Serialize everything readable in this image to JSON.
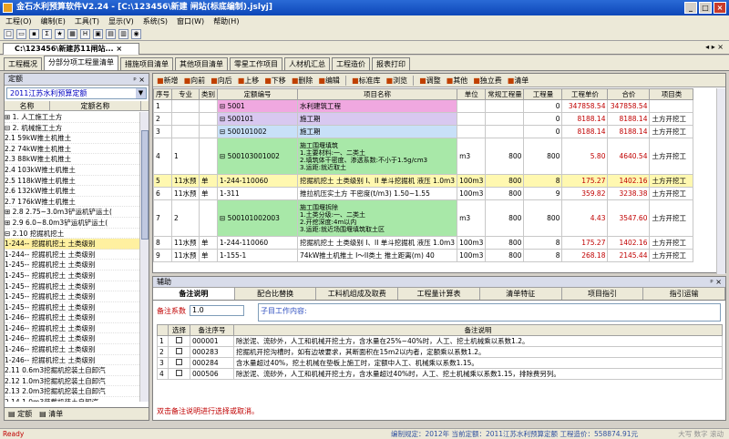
{
  "title": "金石水利预算软件V2.24 - [C:\\123456\\新建      闸站(标底编制).jslyj]",
  "menu": [
    "工程(O)",
    "编制(E)",
    "工具(T)",
    "显示(V)",
    "系统(S)",
    "窗口(W)",
    "帮助(H)"
  ],
  "doc_tab": "C:\\123456\\新建苏11闸站...",
  "main_tabs": [
    "工程概况",
    "分部分项工程量清单",
    "措施项目清单",
    "其他项目清单",
    "零星工作项目",
    "人材机汇总",
    "工程造价",
    "报表打印"
  ],
  "left": {
    "title": "定额",
    "combo": "2011江苏水利预算定额",
    "col_name": "名称",
    "col_code": "定额名称",
    "tree": [
      "⊞ 1. 人工施工土方",
      "⊟ 2. 机械施工土方",
      "  2.1 59kW推土机推土",
      "  2.2 74kW推土机推土",
      "  2.3 88kW推土机推土",
      "  2.4 103kW推土机推土",
      "  2.5 118kW推土机推土",
      "  2.6 132kW推土机推土",
      "  2.7 176kW推土机推土",
      "⊞ 2.8 2.75~3.0m3铲运机铲运土(",
      "⊞ 2.9 6.0~8.0m3铲运机铲运土(",
      "⊟ 2.10 挖掘机挖土",
      "   1-244-- 挖掘机挖土 土类级别",
      "   1-244-- 挖掘机挖土 土类级别",
      "   1-245-- 挖掘机挖土 土类级别",
      "   1-245-- 挖掘机挖土 土类级别",
      "   1-245-- 挖掘机挖土 土类级别",
      "   1-245-- 挖掘机挖土 土类级别",
      "   1-245-- 挖掘机挖土 土类级别",
      "   1-246-- 挖掘机挖土 土类级别",
      "   1-246-- 挖掘机挖土 土类级别",
      "   1-246-- 挖掘机挖土 土类级别",
      "   1-246-- 挖掘机挖土 土类级别",
      "   1-246-- 挖掘机挖土 土类级别",
      "  2.11 0.6m3挖掘机挖装土自卸汽",
      "  2.12 1.0m3挖掘机挖装土自卸汽",
      "  2.13 2.0m3挖掘机挖装土自卸汽",
      "  2.14 1.0m3装载机装土自卸汽"
    ],
    "bottom_tabs": [
      "定额",
      "清单"
    ]
  },
  "toolbar": [
    "新增",
    "向前",
    "向后",
    "上移",
    "下移",
    "删除",
    "编辑",
    "标准库",
    "浏览",
    "调整",
    "其他",
    "独立费",
    "清单"
  ],
  "grid": {
    "headers": [
      "序号",
      "专业",
      "类别",
      "定额编号",
      "项目名称",
      "单位",
      "常规工程量",
      "工程量",
      "工程单价",
      "合价",
      "项目类"
    ],
    "rows": [
      {
        "no": "1",
        "spec": "",
        "cat": "",
        "code": "⊟ 5001",
        "name": "水利建筑工程",
        "unit": "",
        "qty1": "",
        "qty": "0",
        "price": "347858.54",
        "total": "347858.54",
        "type": "",
        "style": "root"
      },
      {
        "no": "2",
        "spec": "",
        "cat": "",
        "code": "⊟ 500101",
        "name": "施工期",
        "unit": "",
        "qty1": "",
        "qty": "0",
        "price": "8188.14",
        "total": "8188.14",
        "type": "土方开挖工",
        "style": "sub"
      },
      {
        "no": "3",
        "spec": "",
        "cat": "",
        "code": "⊟ 500101002",
        "name": "施工期",
        "unit": "",
        "qty1": "",
        "qty": "0",
        "price": "8188.14",
        "total": "8188.14",
        "type": "土方开挖工",
        "style": "item"
      },
      {
        "no": "4",
        "spec": "1",
        "cat": "",
        "code": "⊟ 500103001002",
        "name": "施工围堰填筑\n1.主要材料:一、二类土\n2.填筑体干密度、渗透系数:不小于1.5g/cm3\n3.运距:就近取土",
        "unit": "m3",
        "qty1": "800",
        "qty": "800",
        "price": "5.80",
        "total": "4640.54",
        "type": "土方开挖工",
        "style": "green"
      },
      {
        "no": "5",
        "spec": "11水预",
        "cat": "单",
        "code": "1-244-110060",
        "name": "挖掘机挖土 土类级别 I、II 单斗挖掘机 液压 1.0m3",
        "unit": "100m3",
        "qty1": "800",
        "qty": "8",
        "price": "175.27",
        "total": "1402.16",
        "type": "土方开挖工",
        "style": "yellow"
      },
      {
        "no": "6",
        "spec": "11水预",
        "cat": "单",
        "code": "1-311",
        "name": "推拉机压实土方 干密度(t/m3) 1.50~1.55",
        "unit": "100m3",
        "qty1": "800",
        "qty": "9",
        "price": "359.82",
        "total": "3238.38",
        "type": "土方开挖工",
        "style": ""
      },
      {
        "no": "7",
        "spec": "2",
        "cat": "",
        "code": "⊟ 500101002003",
        "name": "施工围堰拆除\n1.土类分级:一、二类土\n2.开挖深度:4m以内\n3.运距:就近场围堰填筑取土区",
        "unit": "m3",
        "qty1": "800",
        "qty": "800",
        "price": "4.43",
        "total": "3547.60",
        "type": "土方开挖工",
        "style": "green"
      },
      {
        "no": "8",
        "spec": "11水预",
        "cat": "单",
        "code": "1-244-110060",
        "name": "挖掘机挖土 土类级别 I、II 单斗挖掘机 液压 1.0m3",
        "unit": "100m3",
        "qty1": "800",
        "qty": "8",
        "price": "175.27",
        "total": "1402.16",
        "type": "土方开挖工",
        "style": ""
      },
      {
        "no": "9",
        "spec": "11水预",
        "cat": "单",
        "code": "1-155-1",
        "name": "74kW推土机推土 I～II类土 推土距离(m) 40",
        "unit": "100m3",
        "qty1": "800",
        "qty": "8",
        "price": "268.18",
        "total": "2145.44",
        "type": "土方开挖工",
        "style": ""
      }
    ]
  },
  "bottom": {
    "title": "辅助",
    "tabs": [
      "备注说明",
      "配合比替换",
      "工料机组成及取费",
      "工程量计算表",
      "清单特征",
      "项目指引",
      "指引运输"
    ],
    "coef_label": "备注系数",
    "coef_value": "1.0",
    "sub_label": "子目工作内容:",
    "notes_headers": [
      "",
      "选择",
      "备注序号",
      "备注说明"
    ],
    "notes": [
      {
        "no": "1",
        "code": "000001",
        "text": "除淤泥、流砂外，人工和机械开挖土方，含水量在25%~40%时，人工、挖土机械乘以系数1.2。"
      },
      {
        "no": "2",
        "code": "000283",
        "text": "挖掘机开挖沟槽时，如有边坡要求，其断面积在15m2以内者，定额乘以系数1.2。"
      },
      {
        "no": "3",
        "code": "000284",
        "text": "含水量超过40%，挖土机械在垫板上施工时，定额中人工、机械乘以系数1.15。"
      },
      {
        "no": "4",
        "code": "000506",
        "text": "除淤泥、流砂外，人工和机械开挖土方，含水量超过40%时，人工、挖土机械乘以系数1.15，排除费另列。"
      }
    ],
    "hint": "双击备注说明进行选择或取消。"
  },
  "status": {
    "ready": "Ready",
    "info": "编制规定：2012年  当前定额：2011江苏水利预算定额  工程造价：558874.91元",
    "keys": "大写  数字  滚动"
  }
}
